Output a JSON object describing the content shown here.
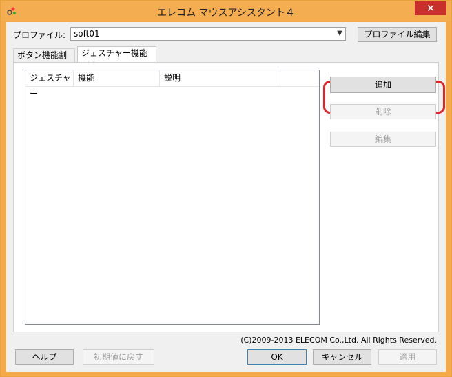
{
  "window": {
    "title": "エレコム マウスアシスタント４",
    "close_glyph": "✕"
  },
  "profile": {
    "label": "プロファイル:",
    "value": "soft01",
    "edit_button": "プロファイル編集"
  },
  "tabs": [
    {
      "label": "ボタン機能割当"
    },
    {
      "label": "ジェスチャー機能割当"
    }
  ],
  "list": {
    "columns": [
      "ジェスチャー",
      "機能",
      "説明"
    ]
  },
  "side_buttons": {
    "add": "追加",
    "delete": "削除",
    "edit": "編集"
  },
  "footer": {
    "copyright": "(C)2009-2013 ELECOM Co.,Ltd. All Rights Reserved.",
    "help": "ヘルプ",
    "reset": "初期値に戻す",
    "ok": "OK",
    "cancel": "キャンセル",
    "apply": "適用"
  },
  "colors": {
    "titlebar": "#f5ad52",
    "close": "#c7302b",
    "highlight": "#e0242c"
  }
}
